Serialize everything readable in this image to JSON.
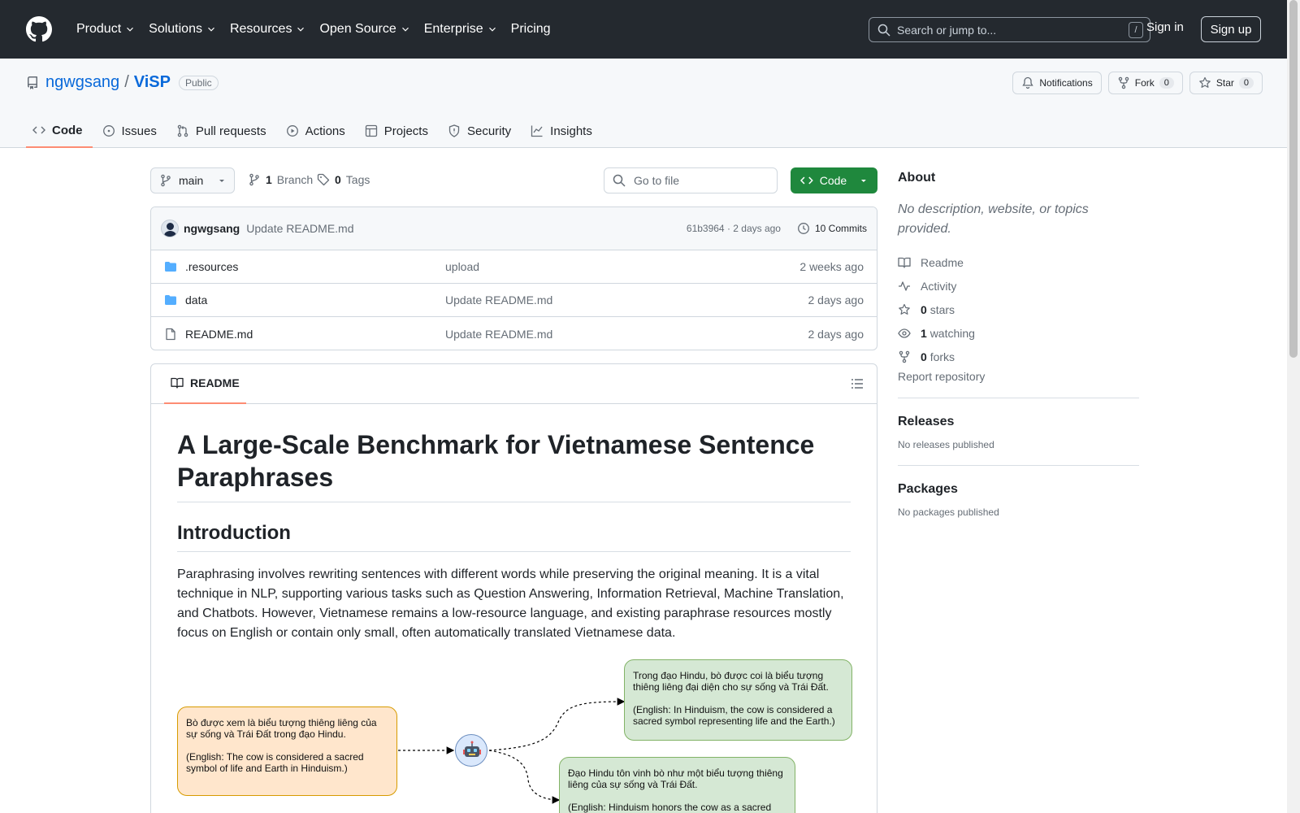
{
  "header": {
    "nav": [
      "Product",
      "Solutions",
      "Resources",
      "Open Source",
      "Enterprise",
      "Pricing"
    ],
    "search_placeholder": "Search or jump to...",
    "search_shortcut": "/",
    "sign_in": "Sign in",
    "sign_up": "Sign up"
  },
  "repo": {
    "owner": "ngwgsang",
    "separator": "/",
    "name": "ViSP",
    "visibility": "Public",
    "notifications": "Notifications",
    "fork_label": "Fork",
    "fork_count": "0",
    "star_label": "Star",
    "star_count": "0",
    "tabs": [
      "Code",
      "Issues",
      "Pull requests",
      "Actions",
      "Projects",
      "Security",
      "Insights"
    ]
  },
  "toolbar": {
    "branch": "main",
    "branch_count": "1",
    "branch_label": "Branch",
    "tag_count": "0",
    "tag_label": "Tags",
    "goto_placeholder": "Go to file",
    "code_button": "Code"
  },
  "commit": {
    "author": "ngwgsang",
    "message": "Update README.md",
    "hash_time": "61b3964 · 2 days ago",
    "commits": "10 Commits"
  },
  "files": [
    {
      "name": ".resources",
      "type": "folder",
      "message": "upload",
      "time": "2 weeks ago"
    },
    {
      "name": "data",
      "type": "folder",
      "message": "Update README.md",
      "time": "2 days ago"
    },
    {
      "name": "README.md",
      "type": "file",
      "message": "Update README.md",
      "time": "2 days ago"
    }
  ],
  "readme": {
    "tab": "README",
    "title": "A Large-Scale Benchmark for Vietnamese Sentence Paraphrases",
    "section": "Introduction",
    "paragraph": "Paraphrasing involves rewriting sentences with different words while preserving the original meaning. It is a vital technique in NLP, supporting various tasks such as Question Answering, Information Retrieval, Machine Translation, and Chatbots. However, Vietnamese remains a low-resource language, and existing paraphrase resources mostly focus on English or contain only small, often automatically translated Vietnamese data.",
    "diagram": {
      "source_vi": "Bò được xem là biểu tượng thiêng liêng của sự sống và Trái Đất trong đạo Hindu.",
      "source_en": "(English: The cow is considered a sacred symbol of life and Earth in Hinduism.)",
      "para1_vi": "Trong đạo Hindu, bò được coi là biểu tượng thiêng liêng đại diện cho sự sống và Trái Đất.",
      "para1_en": "(English: In Hinduism, the cow is considered a sacred symbol representing life and the Earth.)",
      "para2_vi": "Đạo Hindu tôn vinh bò như một biểu tượng thiêng liêng của sự sống và Trái Đất.",
      "para2_en": "(English: Hinduism honors the cow as a sacred"
    }
  },
  "about": {
    "title": "About",
    "description": "No description, website, or topics provided.",
    "readme": "Readme",
    "activity": "Activity",
    "stars_count": "0",
    "stars_label": "stars",
    "watching_count": "1",
    "watching_label": "watching",
    "forks_count": "0",
    "forks_label": "forks",
    "report": "Report repository"
  },
  "releases": {
    "title": "Releases",
    "none": "No releases published"
  },
  "packages": {
    "title": "Packages",
    "none": "No packages published"
  },
  "colors": {
    "header_bg": "#24292f",
    "link": "#0969da",
    "green": "#1f883d",
    "tab_underline": "#fd8c73"
  }
}
